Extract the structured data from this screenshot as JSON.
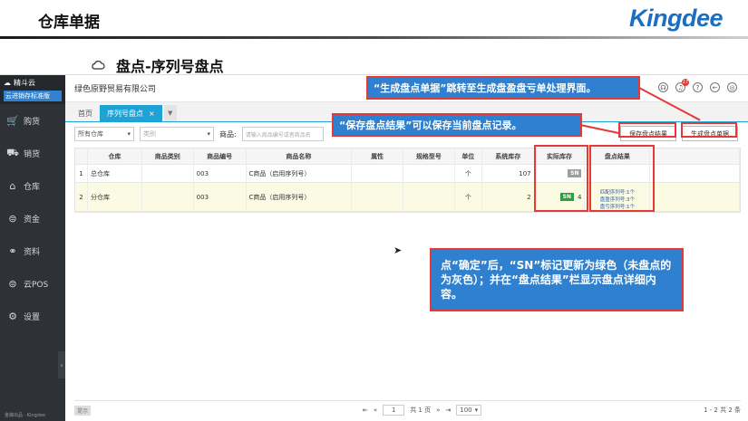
{
  "slide": {
    "title": "仓库单据",
    "logo": "Kingdee",
    "subheading": "盘点-序列号盘点"
  },
  "sidebar": {
    "brand_line1": "精斗云",
    "brand_line2": "云进销存标准版",
    "items": [
      {
        "label": "购货",
        "icon": "cart-icon"
      },
      {
        "label": "销货",
        "icon": "truck-icon"
      },
      {
        "label": "仓库",
        "icon": "warehouse-icon"
      },
      {
        "label": "资金",
        "icon": "money-icon"
      },
      {
        "label": "资料",
        "icon": "data-icon"
      },
      {
        "label": "云POS",
        "icon": "pos-icon"
      },
      {
        "label": "设置",
        "icon": "gear-icon"
      }
    ],
    "footer": "金蝶出品 · Kingdee"
  },
  "header": {
    "company": "绿色原野贸易有限公司",
    "notification_count": "17"
  },
  "tabs": [
    {
      "label": "首页",
      "active": false
    },
    {
      "label": "序列号盘点",
      "active": true
    }
  ],
  "filters": {
    "warehouse": "所有仓库",
    "category_placeholder": "类别",
    "goods_label": "商品:",
    "goods_placeholder": "请输入商品编号或者商品名"
  },
  "actions": {
    "save": "保存盘点结果",
    "generate": "生成盘点单据"
  },
  "grid": {
    "columns": [
      "",
      "仓库",
      "商品类别",
      "商品编号",
      "商品名称",
      "属性",
      "规格型号",
      "单位",
      "系统库存",
      "实际库存",
      "盘点结果"
    ],
    "rows": [
      {
        "index": "1",
        "warehouse": "总仓库",
        "category": "",
        "code": "003",
        "name": "C商品（启用序列号）",
        "attr": "",
        "spec": "",
        "unit": "个",
        "system_stock": "107",
        "sn": "SN",
        "sn_state": "grey",
        "actual": "",
        "result": []
      },
      {
        "index": "2",
        "warehouse": "分仓库",
        "category": "",
        "code": "003",
        "name": "C商品（启用序列号）",
        "attr": "",
        "spec": "",
        "unit": "个",
        "system_stock": "2",
        "sn": "SN",
        "sn_state": "green",
        "actual": "4",
        "result": [
          "匹配序列号:1个",
          "盘盈序列号:3个",
          "盘亏序列号:1个"
        ]
      }
    ]
  },
  "pager": {
    "hint": "提示",
    "page": "1",
    "total_pages": "共 1 页",
    "page_size": "100",
    "range": "1 - 2  共 2 条"
  },
  "callouts": {
    "generate": "“生成盘点单据”跳转至生成盘盈盘亏单处理界面。",
    "save": "“保存盘点结果”可以保存当前盘点记录。",
    "confirm": "点“确定”后，“SN”标记更新为绿色（未盘点的为灰色）；并在“盘点结果”栏显示盘点详细内容。"
  },
  "colors": {
    "accent": "#1fa2d6",
    "callout_bg": "#2f80cf",
    "callout_border": "#e53935",
    "sn_green": "#2e9e3e",
    "sn_grey": "#9e9e9e"
  }
}
